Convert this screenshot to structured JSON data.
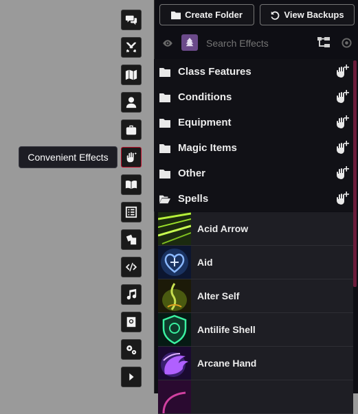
{
  "tooltip": {
    "label": "Convenient Effects"
  },
  "header": {
    "create_folder_label": "Create Folder",
    "view_backups_label": "View Backups"
  },
  "search": {
    "placeholder": "Search Effects"
  },
  "folders": [
    {
      "label": "Class Features",
      "icon": "folder-icon"
    },
    {
      "label": "Conditions",
      "icon": "folder-icon"
    },
    {
      "label": "Equipment",
      "icon": "folder-icon"
    },
    {
      "label": "Magic Items",
      "icon": "folder-icon"
    },
    {
      "label": "Other",
      "icon": "folder-icon"
    },
    {
      "label": "Spells",
      "icon": "folder-open-icon"
    }
  ],
  "effects": [
    {
      "label": "Acid Arrow"
    },
    {
      "label": "Aid"
    },
    {
      "label": "Alter Self"
    },
    {
      "label": "Antilife Shell"
    },
    {
      "label": "Arcane Hand"
    }
  ],
  "sidebar_tabs": [
    {
      "icon": "chat-icon"
    },
    {
      "icon": "combat-icon"
    },
    {
      "icon": "scenes-icon"
    },
    {
      "icon": "actors-icon"
    },
    {
      "icon": "items-icon"
    },
    {
      "icon": "convenient-effects-icon",
      "active": true
    },
    {
      "icon": "journal-icon"
    },
    {
      "icon": "tables-icon"
    },
    {
      "icon": "cards-icon"
    },
    {
      "icon": "macros-icon"
    },
    {
      "icon": "playlists-icon"
    },
    {
      "icon": "compendium-icon"
    },
    {
      "icon": "settings-icon"
    },
    {
      "icon": "collapse-icon"
    }
  ],
  "colors": {
    "active_tab_border": "#c0102a",
    "panel_bg": "#0e0e14",
    "accent": "#6b4a8a"
  }
}
